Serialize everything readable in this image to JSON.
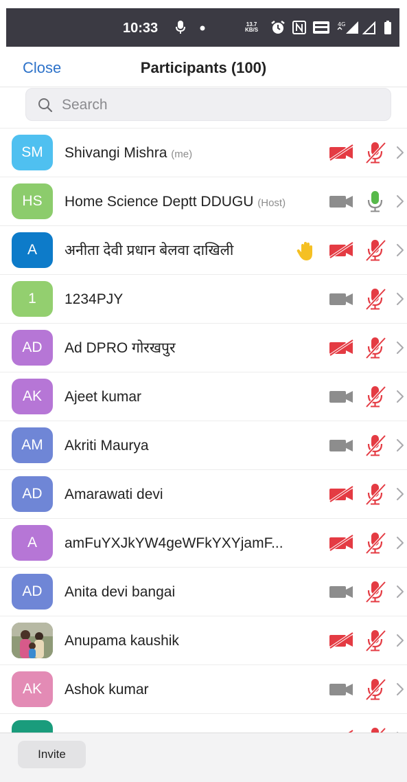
{
  "status_bar": {
    "time": "10:33",
    "net_rate": "13.7",
    "net_rate_unit": "KB/S",
    "network": "4G"
  },
  "header": {
    "close_label": "Close",
    "title": "Participants (100)"
  },
  "search": {
    "placeholder": "Search"
  },
  "participants": [
    {
      "initials": "SM",
      "color": "#4fc0f0",
      "name": "Shivangi Mishra",
      "tag": "(me)",
      "video": "off",
      "audio": "muted",
      "hand": false
    },
    {
      "initials": "HS",
      "color": "#8ccc6c",
      "name": "Home Science Deptt DDUGU",
      "tag": "(Host)",
      "video": "on",
      "audio": "active",
      "hand": false
    },
    {
      "initials": "A",
      "color": "#0d7bc9",
      "name": "अनीता देवी प्रधान बेलवा दाखिली",
      "tag": "",
      "video": "off",
      "audio": "muted",
      "hand": true
    },
    {
      "initials": "1",
      "color": "#93cf6f",
      "name": "1234PJY",
      "tag": "",
      "video": "on",
      "audio": "muted",
      "hand": false
    },
    {
      "initials": "AD",
      "color": "#b676d6",
      "name": "Ad DPRO गोरखपुर",
      "tag": "",
      "video": "off",
      "audio": "muted",
      "hand": false
    },
    {
      "initials": "AK",
      "color": "#b676d6",
      "name": "Ajeet kumar",
      "tag": "",
      "video": "on",
      "audio": "muted",
      "hand": false
    },
    {
      "initials": "AM",
      "color": "#6f86d6",
      "name": "Akriti Maurya",
      "tag": "",
      "video": "on",
      "audio": "muted",
      "hand": false
    },
    {
      "initials": "AD",
      "color": "#6f86d6",
      "name": "Amarawati devi",
      "tag": "",
      "video": "off",
      "audio": "muted",
      "hand": false
    },
    {
      "initials": "A",
      "color": "#b676d6",
      "name": "amFuYXJkYW4geWFkYXYjamF...",
      "tag": "",
      "video": "off",
      "audio": "muted",
      "hand": false
    },
    {
      "initials": "AD",
      "color": "#6f86d6",
      "name": "Anita devi bangai",
      "tag": "",
      "video": "on",
      "audio": "muted",
      "hand": false
    },
    {
      "initials": "",
      "color": "#7a8a6a",
      "name": "Anupama kaushik",
      "tag": "",
      "video": "off",
      "audio": "muted",
      "hand": false,
      "photo": true
    },
    {
      "initials": "AK",
      "color": "#e38bb5",
      "name": "Ashok kumar",
      "tag": "",
      "video": "on",
      "audio": "muted",
      "hand": false
    },
    {
      "initials": "",
      "color": "#1a9c7c",
      "name": "",
      "tag": "",
      "video": "off",
      "audio": "muted",
      "hand": false
    }
  ],
  "footer": {
    "invite_label": "Invite"
  },
  "colors": {
    "accent_blue": "#2d72c9",
    "muted_red": "#e43b43",
    "active_green": "#57b94a",
    "icon_gray": "#8d8d8d"
  }
}
